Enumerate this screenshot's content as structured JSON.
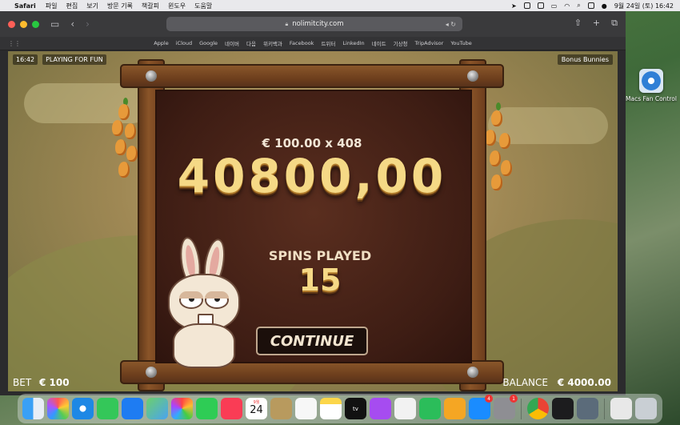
{
  "menubar": {
    "app_name": "Safari",
    "items": [
      "파일",
      "편집",
      "보기",
      "방문 기록",
      "책갈피",
      "윈도우",
      "도움말"
    ],
    "clock": "9월 24일 (토)  16:42"
  },
  "desktop": {
    "icon_label": "Macs Fan Control"
  },
  "browser": {
    "url": "nolimitcity.com",
    "favorites": [
      "Apple",
      "iCloud",
      "Google",
      "네이버",
      "다음",
      "위키백과",
      "Facebook",
      "트위터",
      "LinkedIn",
      "네이트",
      "기상청",
      "TripAdvisor",
      "YouTube"
    ]
  },
  "game": {
    "time": "16:42",
    "mode": "PLAYING FOR FUN",
    "game_name": "Bonus Bunnies",
    "bet_multiplier": "€  100.00 x 408",
    "win_amount": "40800,00",
    "spins_label": "SPINS PLAYED",
    "spins_value": "15",
    "continue_label": "CONTINUE",
    "bet_label": "BET",
    "bet_value": "€  100",
    "balance_label": "BALANCE",
    "balance_value": "€  4000.00"
  },
  "dock": {
    "calendar_month": "9월",
    "calendar_day": "24",
    "tv_label": "tv",
    "appstore_badge": "4",
    "settings_badge": "1"
  },
  "colors": {
    "gold_text": "#f5d986",
    "panel_dark": "#3e1d14",
    "wood": "#8a5428",
    "button_bg": "#1b0f0b"
  }
}
